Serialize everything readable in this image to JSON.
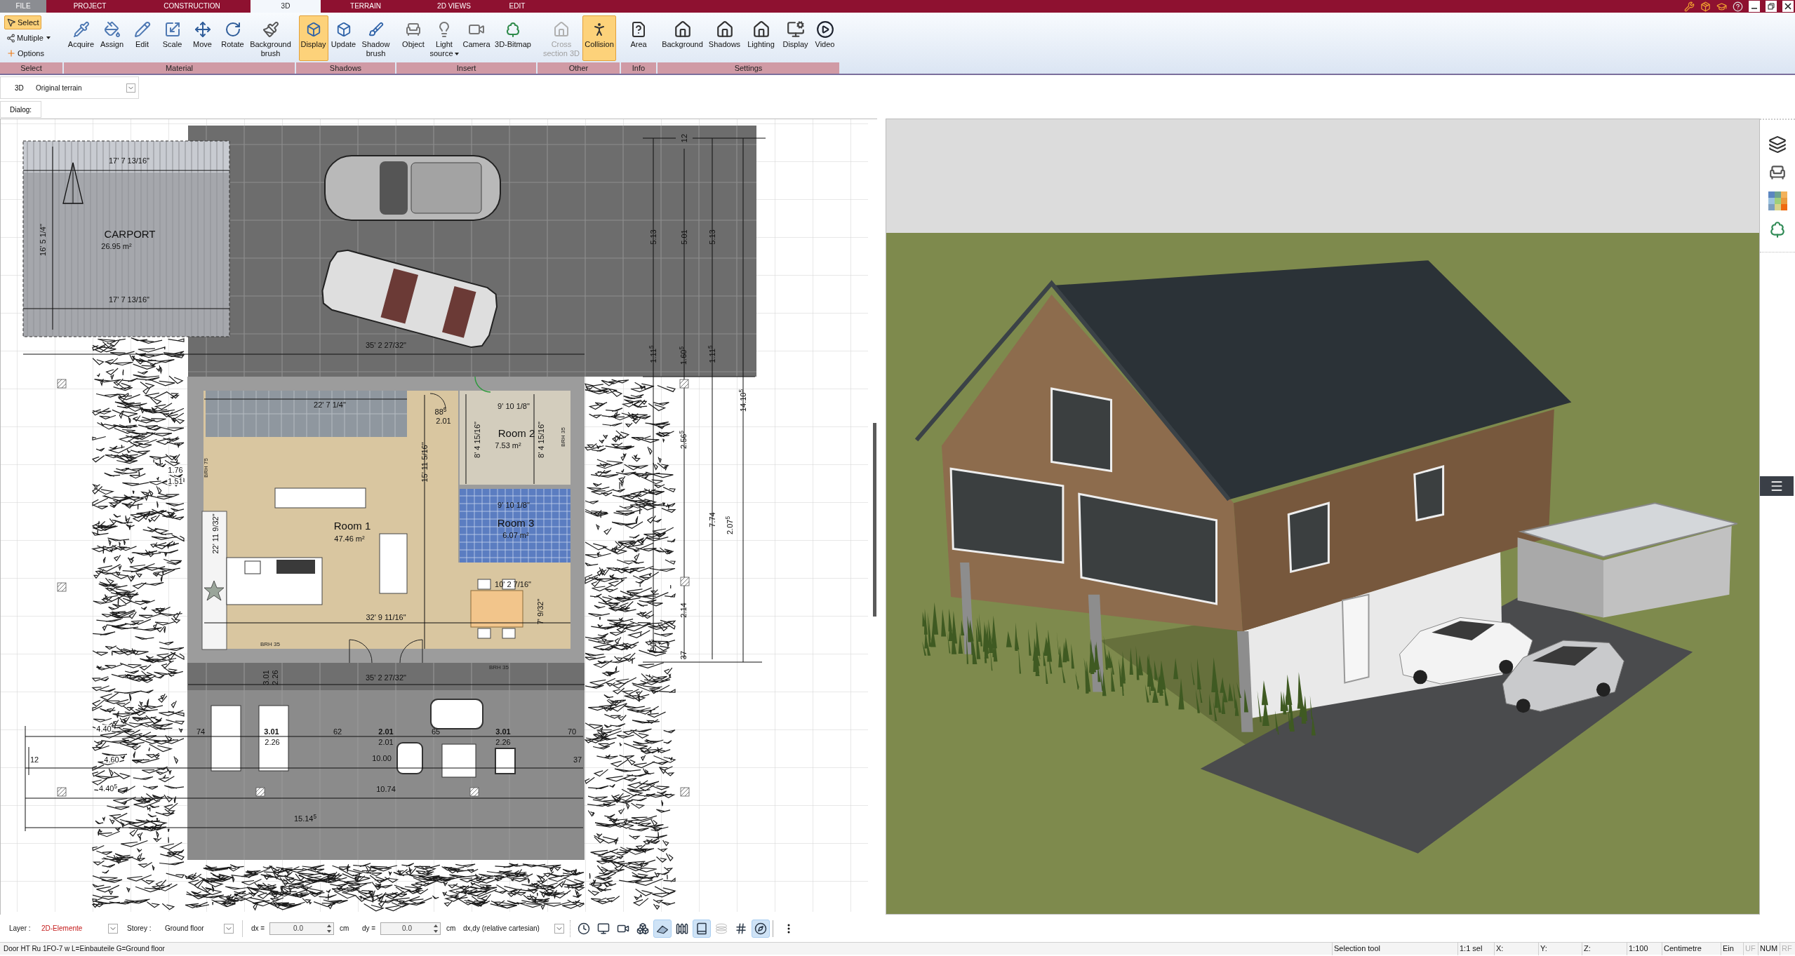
{
  "menu_tabs": [
    {
      "label": "FILE",
      "kind": "file",
      "selected": false
    },
    {
      "label": "PROJECT",
      "kind": "tab",
      "selected": false
    },
    {
      "label": "CONSTRUCTION",
      "kind": "tab",
      "selected": false
    },
    {
      "label": "3D",
      "kind": "tab",
      "selected": true
    },
    {
      "label": "TERRAIN",
      "kind": "tab",
      "selected": false
    },
    {
      "label": "2D VIEWS",
      "kind": "tab",
      "selected": false
    },
    {
      "label": "EDIT",
      "kind": "tab",
      "selected": false
    }
  ],
  "ribbon": {
    "groups": [
      {
        "label": "Select",
        "buttons": [
          {
            "label": "Select",
            "kind": "small",
            "selected": true,
            "disabled": false,
            "dropdown": false
          },
          {
            "label": "Multiple",
            "kind": "small",
            "selected": false,
            "disabled": false,
            "dropdown": true
          },
          {
            "label": "Options",
            "kind": "small",
            "selected": false,
            "disabled": false,
            "dropdown": false
          }
        ]
      },
      {
        "label": "Material",
        "buttons": [
          {
            "label": "Acquire",
            "kind": "large",
            "selected": false,
            "disabled": false,
            "dropdown": false
          },
          {
            "label": "Assign",
            "kind": "large",
            "selected": false,
            "disabled": false,
            "dropdown": false
          },
          {
            "label": "Edit",
            "kind": "large",
            "selected": false,
            "disabled": false,
            "dropdown": false
          },
          {
            "label": "Scale",
            "kind": "large",
            "selected": false,
            "disabled": false,
            "dropdown": false
          },
          {
            "label": "Move",
            "kind": "large",
            "selected": false,
            "disabled": false,
            "dropdown": false
          },
          {
            "label": "Rotate",
            "kind": "large",
            "selected": false,
            "disabled": false,
            "dropdown": false
          },
          {
            "label": "Background brush",
            "kind": "large",
            "selected": false,
            "disabled": false,
            "dropdown": false
          }
        ]
      },
      {
        "label": "Shadows",
        "buttons": [
          {
            "label": "Display",
            "kind": "large",
            "selected": true,
            "disabled": false,
            "dropdown": false
          },
          {
            "label": "Update",
            "kind": "large",
            "selected": false,
            "disabled": false,
            "dropdown": false
          },
          {
            "label": "Shadow brush",
            "kind": "large",
            "selected": false,
            "disabled": false,
            "dropdown": false
          }
        ]
      },
      {
        "label": "Insert",
        "buttons": [
          {
            "label": "Object",
            "kind": "large",
            "selected": false,
            "disabled": false,
            "dropdown": false
          },
          {
            "label": "Light source",
            "kind": "large",
            "selected": false,
            "disabled": false,
            "dropdown": true
          },
          {
            "label": "Camera",
            "kind": "large",
            "selected": false,
            "disabled": false,
            "dropdown": false
          },
          {
            "label": "3D-Bitmap",
            "kind": "large",
            "selected": false,
            "disabled": false,
            "dropdown": false
          }
        ]
      },
      {
        "label": "Other",
        "buttons": [
          {
            "label": "Cross section 3D",
            "kind": "large",
            "selected": false,
            "disabled": true,
            "dropdown": false
          },
          {
            "label": "Collision",
            "kind": "large",
            "selected": true,
            "disabled": false,
            "dropdown": false
          }
        ]
      },
      {
        "label": "Info",
        "buttons": [
          {
            "label": "Area",
            "kind": "large",
            "selected": false,
            "disabled": false,
            "dropdown": false
          }
        ]
      },
      {
        "label": "Settings",
        "buttons": [
          {
            "label": "Background",
            "kind": "large",
            "selected": false,
            "disabled": false,
            "dropdown": false
          },
          {
            "label": "Shadows",
            "kind": "large",
            "selected": false,
            "disabled": false,
            "dropdown": false
          },
          {
            "label": "Lighting",
            "kind": "large",
            "selected": false,
            "disabled": false,
            "dropdown": false
          },
          {
            "label": "Display",
            "kind": "large",
            "selected": false,
            "disabled": false,
            "dropdown": false
          },
          {
            "label": "Video",
            "kind": "large",
            "selected": false,
            "disabled": false,
            "dropdown": false
          }
        ]
      }
    ]
  },
  "view_bar": {
    "label": "3D",
    "terrain": "Original terrain"
  },
  "dialog_bar": {
    "label": "Dialog:"
  },
  "plan_view": {
    "labels": [
      {
        "text": "17' 7 13/16\"",
        "kind": "dim"
      },
      {
        "text": "CARPORT",
        "kind": "room"
      },
      {
        "text": "26.95 m²",
        "kind": "area"
      },
      {
        "text": "16' 5 1/4\"",
        "kind": "dim"
      },
      {
        "text": "17' 7 13/16\"",
        "kind": "dim"
      },
      {
        "text": "35' 2 27/32\"",
        "kind": "dim"
      },
      {
        "text": "12",
        "kind": "dim"
      },
      {
        "text": "5.13",
        "kind": "dim"
      },
      {
        "text": "5.01",
        "kind": "dim"
      },
      {
        "text": "5.13",
        "kind": "dim"
      },
      {
        "text": "1.11$^{5}$",
        "kind": "dim"
      },
      {
        "text": "1.60$^{5}$",
        "kind": "dim"
      },
      {
        "text": "1.11$^{5}$",
        "kind": "dim"
      },
      {
        "text": "14.10$^{5}$",
        "kind": "dim"
      },
      {
        "text": "22' 7 1/4\"",
        "kind": "dim"
      },
      {
        "text": "88$^{5}$",
        "kind": "dim"
      },
      {
        "text": "2.01",
        "kind": "dim"
      },
      {
        "text": "9' 10 1/8\"",
        "kind": "dim"
      },
      {
        "text": "Room 2",
        "kind": "room"
      },
      {
        "text": "7.53 m²",
        "kind": "area"
      },
      {
        "text": "8' 4 15/16\"",
        "kind": "dim"
      },
      {
        "text": "8' 4 15/16\"",
        "kind": "dim"
      },
      {
        "text": "BRH 35",
        "kind": "note"
      },
      {
        "text": "2.56$^{5}$",
        "kind": "dim"
      },
      {
        "text": "15' 11 5/16\"",
        "kind": "dim"
      },
      {
        "text": "BRH 75",
        "kind": "note"
      },
      {
        "text": "1.76",
        "kind": "dim"
      },
      {
        "text": "1.51",
        "kind": "dim"
      },
      {
        "text": "9' 10 1/8\"",
        "kind": "dim"
      },
      {
        "text": "Room 3",
        "kind": "room"
      },
      {
        "text": "6.07 m²",
        "kind": "area"
      },
      {
        "text": "7.74",
        "kind": "dim"
      },
      {
        "text": "2.07$^{5}$",
        "kind": "dim"
      },
      {
        "text": "Room 1",
        "kind": "room"
      },
      {
        "text": "47.46 m²",
        "kind": "area"
      },
      {
        "text": "22' 11 9/32\"",
        "kind": "dim"
      },
      {
        "text": "10' 2 7/16\"",
        "kind": "dim"
      },
      {
        "text": "7' 9/32\"",
        "kind": "dim"
      },
      {
        "text": "2.14",
        "kind": "dim"
      },
      {
        "text": "32' 9 11/16\"",
        "kind": "dim"
      },
      {
        "text": "BRH 35",
        "kind": "note"
      },
      {
        "text": "90$^{5}$",
        "kind": "dim"
      },
      {
        "text": "37",
        "kind": "dim"
      },
      {
        "text": "BRH 35",
        "kind": "note"
      },
      {
        "text": "35' 2 27/32\"",
        "kind": "dim"
      },
      {
        "text": "3.01",
        "kind": "dim"
      },
      {
        "text": "2.26",
        "kind": "dim"
      },
      {
        "text": "4.40",
        "kind": "dim"
      },
      {
        "text": "74",
        "kind": "dim"
      },
      {
        "text": "3.01",
        "kind": "dim_bold"
      },
      {
        "text": "62",
        "kind": "dim"
      },
      {
        "text": "2.01",
        "kind": "dim_bold"
      },
      {
        "text": "65",
        "kind": "dim"
      },
      {
        "text": "3.01",
        "kind": "dim_bold"
      },
      {
        "text": "70",
        "kind": "dim"
      },
      {
        "text": "2.26",
        "kind": "dim"
      },
      {
        "text": "2.01",
        "kind": "dim"
      },
      {
        "text": "2.26",
        "kind": "dim"
      },
      {
        "text": "12",
        "kind": "dim"
      },
      {
        "text": "4.60",
        "kind": "dim"
      },
      {
        "text": "10.00",
        "kind": "dim"
      },
      {
        "text": "37",
        "kind": "dim"
      },
      {
        "text": "4.40$^{5}$",
        "kind": "dim"
      },
      {
        "text": "10.74",
        "kind": "dim"
      },
      {
        "text": "15.14$^{5}$",
        "kind": "dim"
      }
    ]
  },
  "bottom_toolbar": {
    "layer": {
      "label": "Layer :",
      "value": "2D-Elemente"
    },
    "storey": {
      "label": "Storey :",
      "value": "Ground floor"
    },
    "dx": {
      "label": "dx =",
      "value": "0.0",
      "unit": "cm"
    },
    "dy": {
      "label": "dy =",
      "value": "0.0",
      "unit": "cm"
    },
    "coordinate_mode": {
      "value": "dx,dy (relative cartesian)"
    },
    "tools": [
      {
        "selected": false
      },
      {
        "selected": false
      },
      {
        "selected": false
      },
      {
        "selected": false
      },
      {
        "selected": true
      },
      {
        "selected": false
      },
      {
        "selected": true
      },
      {
        "selected": false
      },
      {
        "selected": false
      },
      {
        "selected": true
      }
    ]
  },
  "status_bar": {
    "message": "Door HT Ru 1FO-7 w L=Einbauteile G=Ground floor",
    "cells": [
      {
        "text": "Selection tool",
        "disabled": false
      },
      {
        "text": "1:1 sel",
        "disabled": false
      },
      {
        "text": "X:",
        "disabled": false
      },
      {
        "text": "Y:",
        "disabled": false
      },
      {
        "text": "Z:",
        "disabled": false
      },
      {
        "text": "1:100",
        "disabled": false
      },
      {
        "text": "Centimetre",
        "disabled": false
      },
      {
        "text": "Ein",
        "disabled": false
      },
      {
        "text": "UF",
        "disabled": true
      },
      {
        "text": "NUM",
        "disabled": false
      },
      {
        "text": "RF",
        "disabled": true
      }
    ]
  }
}
